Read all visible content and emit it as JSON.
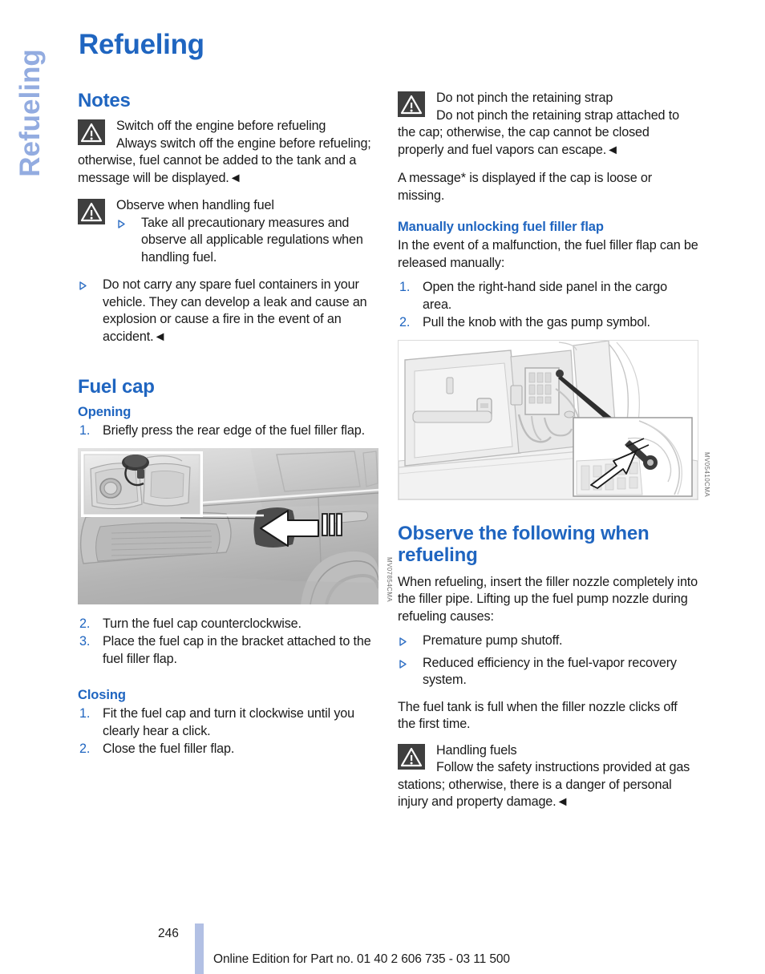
{
  "side_tab": "Refueling",
  "page_title": "Refueling",
  "colors": {
    "heading_blue": "#1f65c0",
    "side_tab_blue": "#93ace0",
    "warning_icon_bg": "#3f3f3f",
    "footer_bar_blue": "#b2c0e4",
    "body_text": "#1a1a1a"
  },
  "left_column": {
    "notes": {
      "heading": "Notes",
      "warning_1": {
        "title": "Switch off the engine before refueling",
        "body": "Always switch off the engine before refueling; otherwise, fuel cannot be added to the tank and a message will be displayed.◄"
      },
      "warning_2": {
        "title": "Observe when handling fuel",
        "bullets": [
          "Take all precautionary measures and observe all applicable regulations when handling fuel."
        ]
      },
      "bullets": [
        "Do not carry any spare fuel containers in your vehicle. They can develop a leak and cause an explosion or cause a fire in the event of an accident.◄"
      ]
    },
    "fuel_cap": {
      "heading": "Fuel cap",
      "opening": {
        "heading": "Opening",
        "steps": [
          {
            "num": "1.",
            "text": "Briefly press the rear edge of the fuel filler flap."
          }
        ],
        "figure_code": "MV07854CMA",
        "steps_after": [
          {
            "num": "2.",
            "text": "Turn the fuel cap counterclockwise."
          },
          {
            "num": "3.",
            "text": "Place the fuel cap in the bracket attached to the fuel filler flap."
          }
        ]
      },
      "closing": {
        "heading": "Closing",
        "steps": [
          {
            "num": "1.",
            "text": "Fit the fuel cap and turn it clockwise until you clearly hear a click."
          },
          {
            "num": "2.",
            "text": "Close the fuel filler flap."
          }
        ]
      }
    }
  },
  "right_column": {
    "warning_strap": {
      "title": "Do not pinch the retaining strap",
      "body": "Do not pinch the retaining strap attached to the cap; otherwise, the cap cannot be closed properly and fuel vapors can escape.◄"
    },
    "message_note": "A message* is displayed if the cap is loose or missing.",
    "manual_unlock": {
      "heading": "Manually unlocking fuel filler flap",
      "intro": "In the event of a malfunction, the fuel filler flap can be released manually:",
      "steps": [
        {
          "num": "1.",
          "text": "Open the right-hand side panel in the cargo area."
        },
        {
          "num": "2.",
          "text": "Pull the knob with the gas pump symbol."
        }
      ],
      "figure_code": "MV05410CMA"
    },
    "observe": {
      "heading": "Observe the following when refueling",
      "intro": "When refueling, insert the filler nozzle completely into the filler pipe. Lifting up the fuel pump nozzle during refueling causes:",
      "bullets": [
        "Premature pump shutoff.",
        "Reduced efficiency in the fuel-vapor recovery system."
      ],
      "closing_note": "The fuel tank is full when the filler nozzle clicks off the first time.",
      "warning": {
        "title": "Handling fuels",
        "body": "Follow the safety instructions provided at gas stations; otherwise, there is a danger of personal injury and property damage.◄"
      }
    }
  },
  "footer": {
    "page_number": "246",
    "text": "Online Edition for Part no. 01 40 2 606 735 - 03 11 500"
  }
}
